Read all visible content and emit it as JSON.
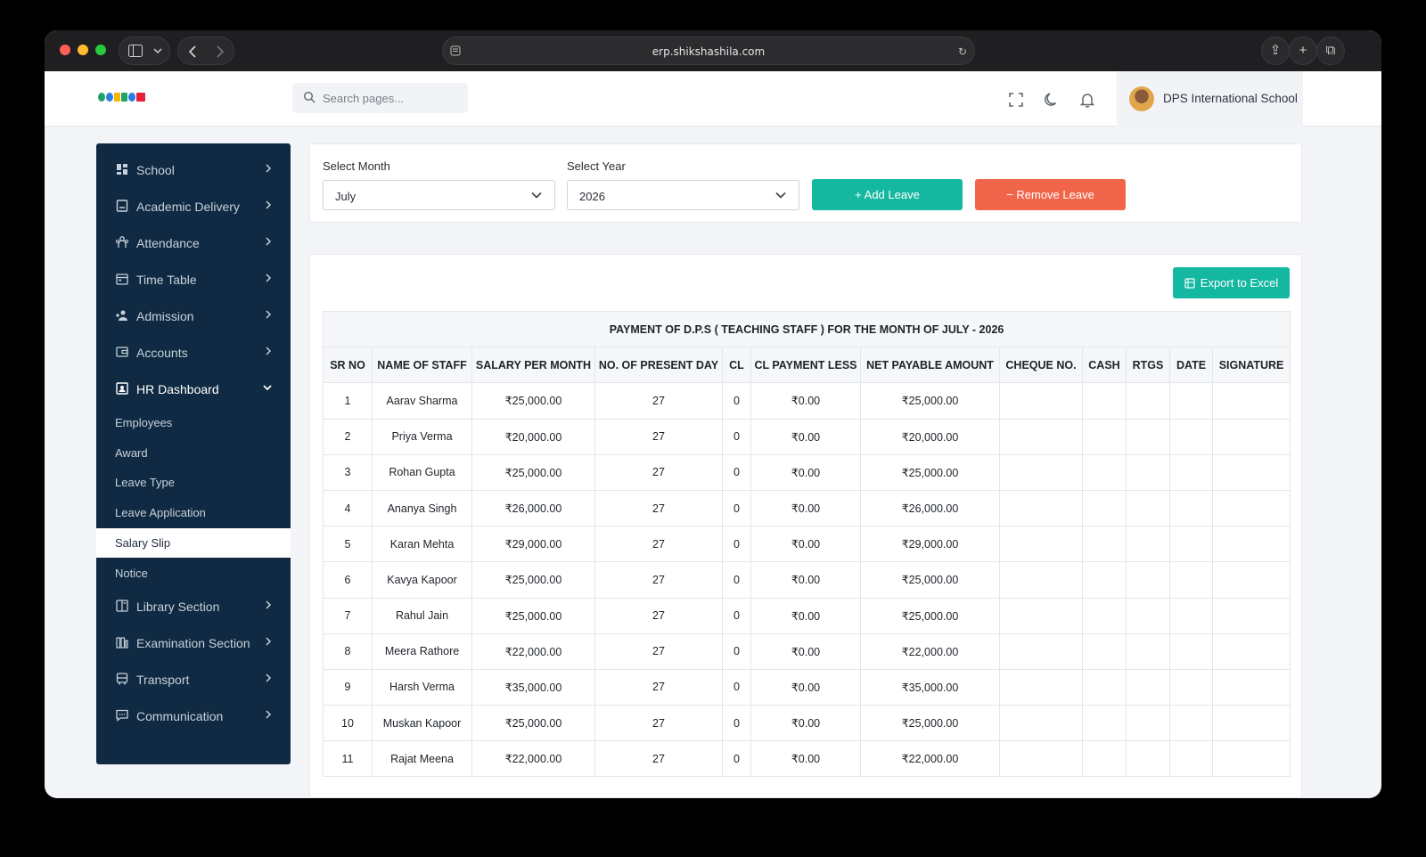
{
  "browser": {
    "url": "erp.shikshashila.com"
  },
  "header": {
    "search_placeholder": "Search pages...",
    "school_name": "DPS International School",
    "icons": [
      "fullscreen-icon",
      "moon-icon",
      "bell-icon"
    ]
  },
  "sidebar": {
    "items": [
      {
        "label": "School",
        "icon": "dashboard-icon"
      },
      {
        "label": "Academic Delivery",
        "icon": "book-icon"
      },
      {
        "label": "Attendance",
        "icon": "users-icon"
      },
      {
        "label": "Time Table",
        "icon": "calendar-icon"
      },
      {
        "label": "Admission",
        "icon": "user-plus-icon"
      },
      {
        "label": "Accounts",
        "icon": "wallet-icon"
      },
      {
        "label": "HR Dashboard",
        "icon": "id-card-icon"
      },
      {
        "label": "Library Section",
        "icon": "library-icon"
      },
      {
        "label": "Examination Section",
        "icon": "exam-icon"
      },
      {
        "label": "Transport",
        "icon": "bus-icon"
      },
      {
        "label": "Communication",
        "icon": "chat-icon"
      }
    ],
    "hr_sub_items": [
      {
        "label": "Employees"
      },
      {
        "label": "Award"
      },
      {
        "label": "Leave Type"
      },
      {
        "label": "Leave Application"
      },
      {
        "label": "Salary Slip"
      },
      {
        "label": "Notice"
      }
    ]
  },
  "filters": {
    "month_label": "Select Month",
    "month_value": "July",
    "year_label": "Select Year",
    "year_value": "2026",
    "add_leave": "+  Add Leave",
    "remove_leave": "−  Remove Leave"
  },
  "table": {
    "export_label": "Export to Excel",
    "title": "PAYMENT OF D.P.S ( TEACHING STAFF ) FOR THE MONTH OF JULY - 2026",
    "columns": [
      "SR NO",
      "NAME OF STAFF",
      "SALARY PER MONTH",
      "NO. OF PRESENT DAY",
      "CL",
      "CL PAYMENT LESS",
      "NET PAYABLE AMOUNT",
      "CHEQUE NO.",
      "CASH",
      "RTGS",
      "DATE",
      "SIGNATURE"
    ],
    "rows": [
      [
        "1",
        "Aarav Sharma",
        "₹25,000.00",
        "27",
        "0",
        "₹0.00",
        "₹25,000.00",
        "",
        "",
        "",
        "",
        ""
      ],
      [
        "2",
        "Priya Verma",
        "₹20,000.00",
        "27",
        "0",
        "₹0.00",
        "₹20,000.00",
        "",
        "",
        "",
        "",
        ""
      ],
      [
        "3",
        "Rohan Gupta",
        "₹25,000.00",
        "27",
        "0",
        "₹0.00",
        "₹25,000.00",
        "",
        "",
        "",
        "",
        ""
      ],
      [
        "4",
        "Ananya Singh",
        "₹26,000.00",
        "27",
        "0",
        "₹0.00",
        "₹26,000.00",
        "",
        "",
        "",
        "",
        ""
      ],
      [
        "5",
        "Karan Mehta",
        "₹29,000.00",
        "27",
        "0",
        "₹0.00",
        "₹29,000.00",
        "",
        "",
        "",
        "",
        ""
      ],
      [
        "6",
        "Kavya Kapoor",
        "₹25,000.00",
        "27",
        "0",
        "₹0.00",
        "₹25,000.00",
        "",
        "",
        "",
        "",
        ""
      ],
      [
        "7",
        "Rahul Jain",
        "₹25,000.00",
        "27",
        "0",
        "₹0.00",
        "₹25,000.00",
        "",
        "",
        "",
        "",
        ""
      ],
      [
        "8",
        "Meera Rathore",
        "₹22,000.00",
        "27",
        "0",
        "₹0.00",
        "₹22,000.00",
        "",
        "",
        "",
        "",
        ""
      ],
      [
        "9",
        "Harsh Verma",
        "₹35,000.00",
        "27",
        "0",
        "₹0.00",
        "₹35,000.00",
        "",
        "",
        "",
        "",
        ""
      ],
      [
        "10",
        "Muskan Kapoor",
        "₹25,000.00",
        "27",
        "0",
        "₹0.00",
        "₹25,000.00",
        "",
        "",
        "",
        "",
        ""
      ],
      [
        "11",
        "Rajat Meena",
        "₹22,000.00",
        "27",
        "0",
        "₹0.00",
        "₹22,000.00",
        "",
        "",
        "",
        "",
        ""
      ]
    ]
  },
  "colors": {
    "sidebar_bg": "#0f2a42",
    "accent_teal": "#14b8a0",
    "accent_red": "#f1664a"
  }
}
